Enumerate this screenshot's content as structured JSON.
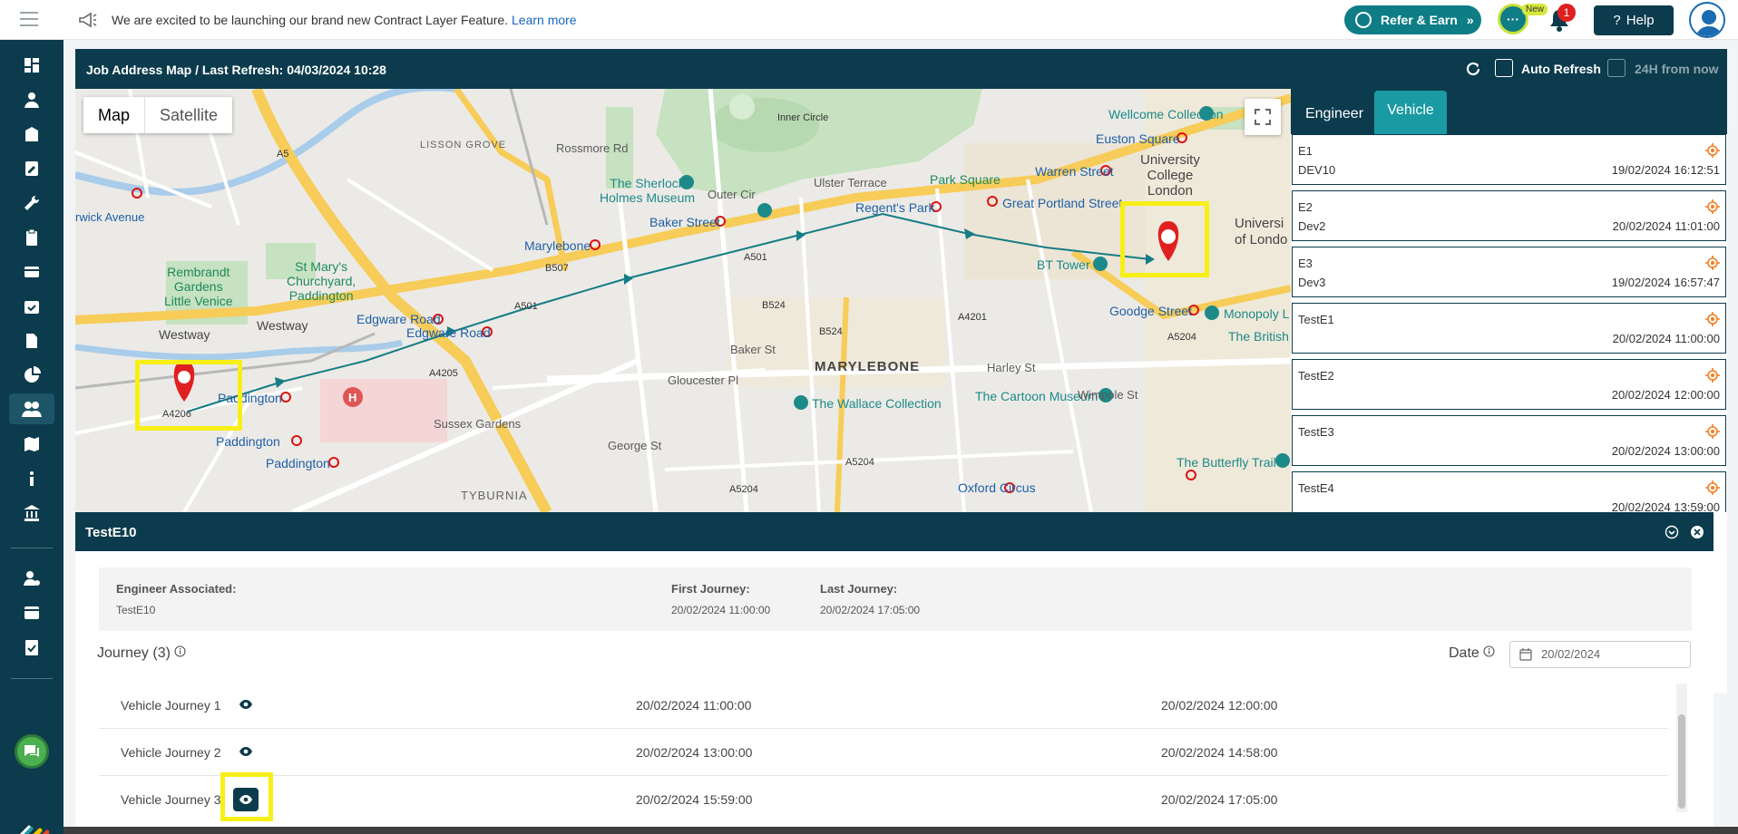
{
  "announcement": {
    "text": "We are excited to be launching our brand new Contract Layer Feature.",
    "link": "Learn more"
  },
  "topbar": {
    "refer_label": "Refer & Earn",
    "new_badge": "New",
    "notification_count": "1",
    "help_label": "Help"
  },
  "header": {
    "title": "Job Address Map",
    "separator": "/",
    "last_refresh": "Last Refresh: 04/03/2024 10:28",
    "auto_refresh_label": "Auto Refresh",
    "future_label": "24H from now"
  },
  "map": {
    "toggle": {
      "map": "Map",
      "satellite": "Satellite"
    },
    "labels": {
      "lisson_grove": "LISSON GROVE",
      "marylebone_district": "MARYLEBONE",
      "tyburnia": "TYBURNIA",
      "sherlock": "The Sherlock Holmes Museum",
      "sherlock_1": "The Sherlock",
      "sherlock_2": "Holmes Museum",
      "wallace": "The Wallace Collection",
      "cartoon": "The Cartoon Museum",
      "bt_tower": "BT Tower",
      "ucl_1": "University",
      "ucl_2": "College",
      "ucl_3": "London",
      "wellcome": "Wellcome Collection",
      "euston_sq": "Euston Square",
      "warren_st": "Warren Street",
      "great_portland": "Great Portland Street",
      "regents_park": "Regent's Park",
      "park_square": "Park Square",
      "baker_st": "Baker Street",
      "marylebone_stn": "Marylebone",
      "edgware_rd_1": "Edgware Road",
      "edgware_rd_2": "Edgware Road",
      "paddington_1": "Paddington",
      "paddington_2": "Paddington",
      "paddington_3": "Paddington",
      "goodge_st": "Goodge Street",
      "oxford_circus": "Oxford Circus",
      "st_marys": "St Mary's Church, Paddington",
      "st_marys_1": "St Mary's",
      "st_marys_2": "Churchyard,",
      "st_marys_3": "Paddington",
      "rembrandt_1": "Rembrandt",
      "rembrandt_2": "Gardens",
      "rembrandt_3": "Little Venice",
      "warwick_ave": "rwick Avenue",
      "westway_1": "Westway",
      "westway_2": "Westway",
      "monopoly": "Monopoly L",
      "british": "The British",
      "butterfly": "The Butterfly Trail",
      "universi_1": "Universi",
      "universi_2": "of Londo",
      "inner_circle": "Inner Circle",
      "outer_cir": "Outer Cir",
      "outer_circle": "Outer Circle",
      "ulster": "Ulster Terrace",
      "george_st": "George St",
      "rossmore": "Rossmore Rd",
      "a501_1": "A501",
      "a501_2": "A501",
      "a5": "A5",
      "a4201": "A4201",
      "a5204_1": "A5204",
      "a5204_2": "A5204",
      "a5204_3": "A5204",
      "b524": "B524",
      "b524_2": "B524",
      "b507": "B507",
      "a4205": "A4205",
      "a4206": "A4206",
      "baker_st_road": "Baker St",
      "gloucester_pl": "Gloucester Pl",
      "sussex_gardens": "Sussex Gardens",
      "harley_st": "Harley St",
      "wimpole_st": "Wimpole St"
    }
  },
  "right_panel": {
    "tabs": [
      "Engineer",
      "Vehicle"
    ],
    "active_tab": "Vehicle",
    "vehicles": [
      {
        "name": "E1",
        "sub": "DEV10",
        "time": "19/02/2024 16:12:51"
      },
      {
        "name": "E2",
        "sub": "Dev2",
        "time": "20/02/2024 11:01:00"
      },
      {
        "name": "E3",
        "sub": "Dev3",
        "time": "19/02/2024 16:57:47"
      },
      {
        "name": "TestE1",
        "sub": "",
        "time": "20/02/2024 11:00:00"
      },
      {
        "name": "TestE2",
        "sub": "",
        "time": "20/02/2024 12:00:00"
      },
      {
        "name": "TestE3",
        "sub": "",
        "time": "20/02/2024 13:00:00"
      },
      {
        "name": "TestE4",
        "sub": "",
        "time": "20/02/2024 13:59:00"
      }
    ]
  },
  "detail": {
    "title": "TestE10",
    "engineer_label": "Engineer Associated:",
    "engineer_value": "TestE10",
    "first_label": "First Journey:",
    "first_value": "20/02/2024 11:00:00",
    "last_label": "Last Journey:",
    "last_value": "20/02/2024 17:05:00",
    "journey_title": "Journey (3)",
    "date_label": "Date",
    "date_value": "20/02/2024",
    "journeys": [
      {
        "name": "Vehicle Journey 1",
        "start": "20/02/2024 11:00:00",
        "end": "20/02/2024 12:00:00"
      },
      {
        "name": "Vehicle Journey 2",
        "start": "20/02/2024 13:00:00",
        "end": "20/02/2024 14:58:00"
      },
      {
        "name": "Vehicle Journey 3",
        "start": "20/02/2024 15:59:00",
        "end": "20/02/2024 17:05:00"
      }
    ]
  },
  "colors": {
    "primary": "#0b3b4c",
    "accent": "#1a9aa3",
    "route": "#167d86",
    "highlight": "#f7ef16"
  }
}
